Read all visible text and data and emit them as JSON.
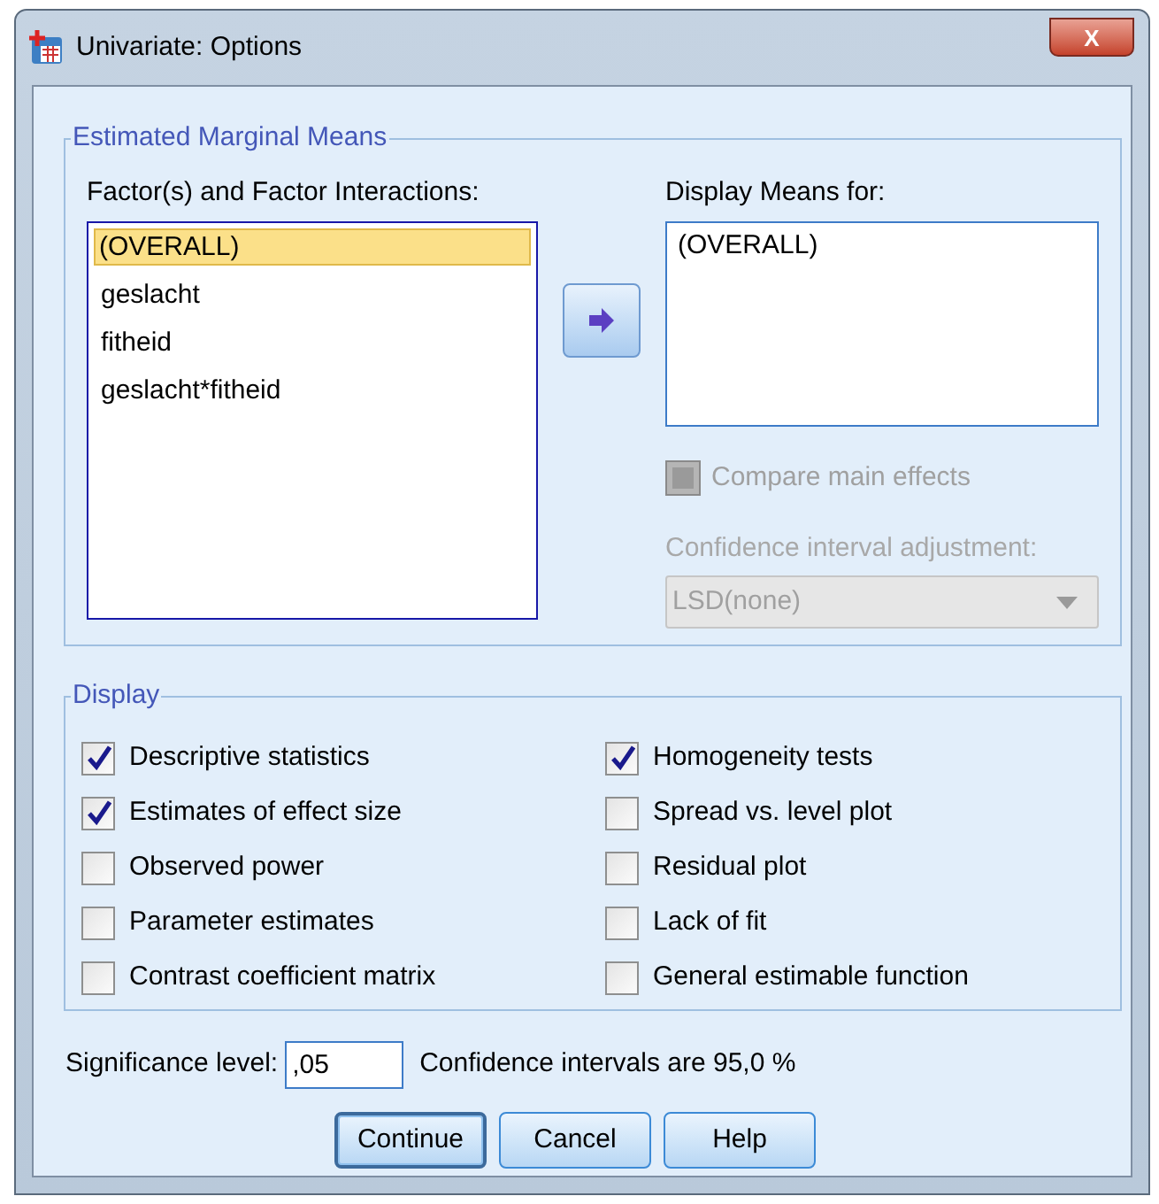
{
  "window": {
    "title": "Univariate: Options",
    "close_label": "X"
  },
  "estimated_marginal_means": {
    "title": "Estimated Marginal Means",
    "factors_label": "Factor(s) and Factor Interactions:",
    "factors": [
      {
        "label": "(OVERALL)",
        "selected": true
      },
      {
        "label": "geslacht",
        "selected": false
      },
      {
        "label": "fitheid",
        "selected": false
      },
      {
        "label": "geslacht*fitheid",
        "selected": false
      }
    ],
    "display_means_label": "Display Means for:",
    "display_means": [
      "(OVERALL)"
    ],
    "compare_main_effects": {
      "label": "Compare main effects",
      "checked": false,
      "disabled": true
    },
    "adjustment_label": "Confidence interval adjustment:",
    "adjustment": {
      "value": "LSD(none)",
      "disabled": true
    }
  },
  "display": {
    "title": "Display",
    "options": [
      {
        "label": "Descriptive statistics",
        "checked": true
      },
      {
        "label": "Homogeneity tests",
        "checked": true
      },
      {
        "label": "Estimates of effect size",
        "checked": true
      },
      {
        "label": "Spread vs. level plot",
        "checked": false
      },
      {
        "label": "Observed power",
        "checked": false
      },
      {
        "label": "Residual plot",
        "checked": false
      },
      {
        "label": "Parameter estimates",
        "checked": false
      },
      {
        "label": "Lack of fit",
        "checked": false
      },
      {
        "label": "Contrast coefficient matrix",
        "checked": false
      },
      {
        "label": "General estimable function",
        "checked": false
      }
    ]
  },
  "significance": {
    "label": "Significance level:",
    "value": ",05",
    "note": "Confidence intervals are 95,0 %"
  },
  "buttons": [
    {
      "label": "Continue",
      "selected": true
    },
    {
      "label": "Cancel",
      "selected": false
    },
    {
      "label": "Help",
      "selected": false
    }
  ]
}
